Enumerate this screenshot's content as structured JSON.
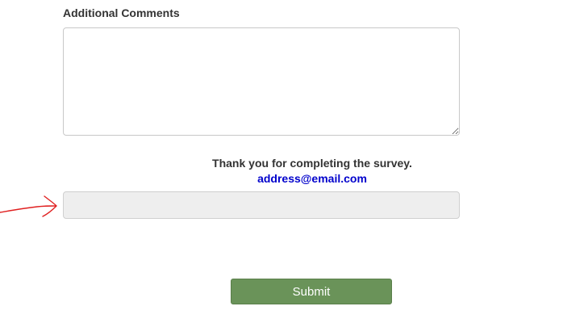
{
  "comments": {
    "label": "Additional Comments",
    "value": ""
  },
  "thanks": {
    "message": "Thank you for completing the survey.",
    "email": "address@email.com"
  },
  "extra_field": {
    "value": ""
  },
  "submit": {
    "label": "Submit"
  },
  "colors": {
    "submit_bg": "#6a9359",
    "email_link": "#0000cc",
    "annotation_arrow": "#e02020",
    "field_bg": "#eeeeee"
  },
  "icons": {
    "annotation": "red-arrow-icon"
  }
}
